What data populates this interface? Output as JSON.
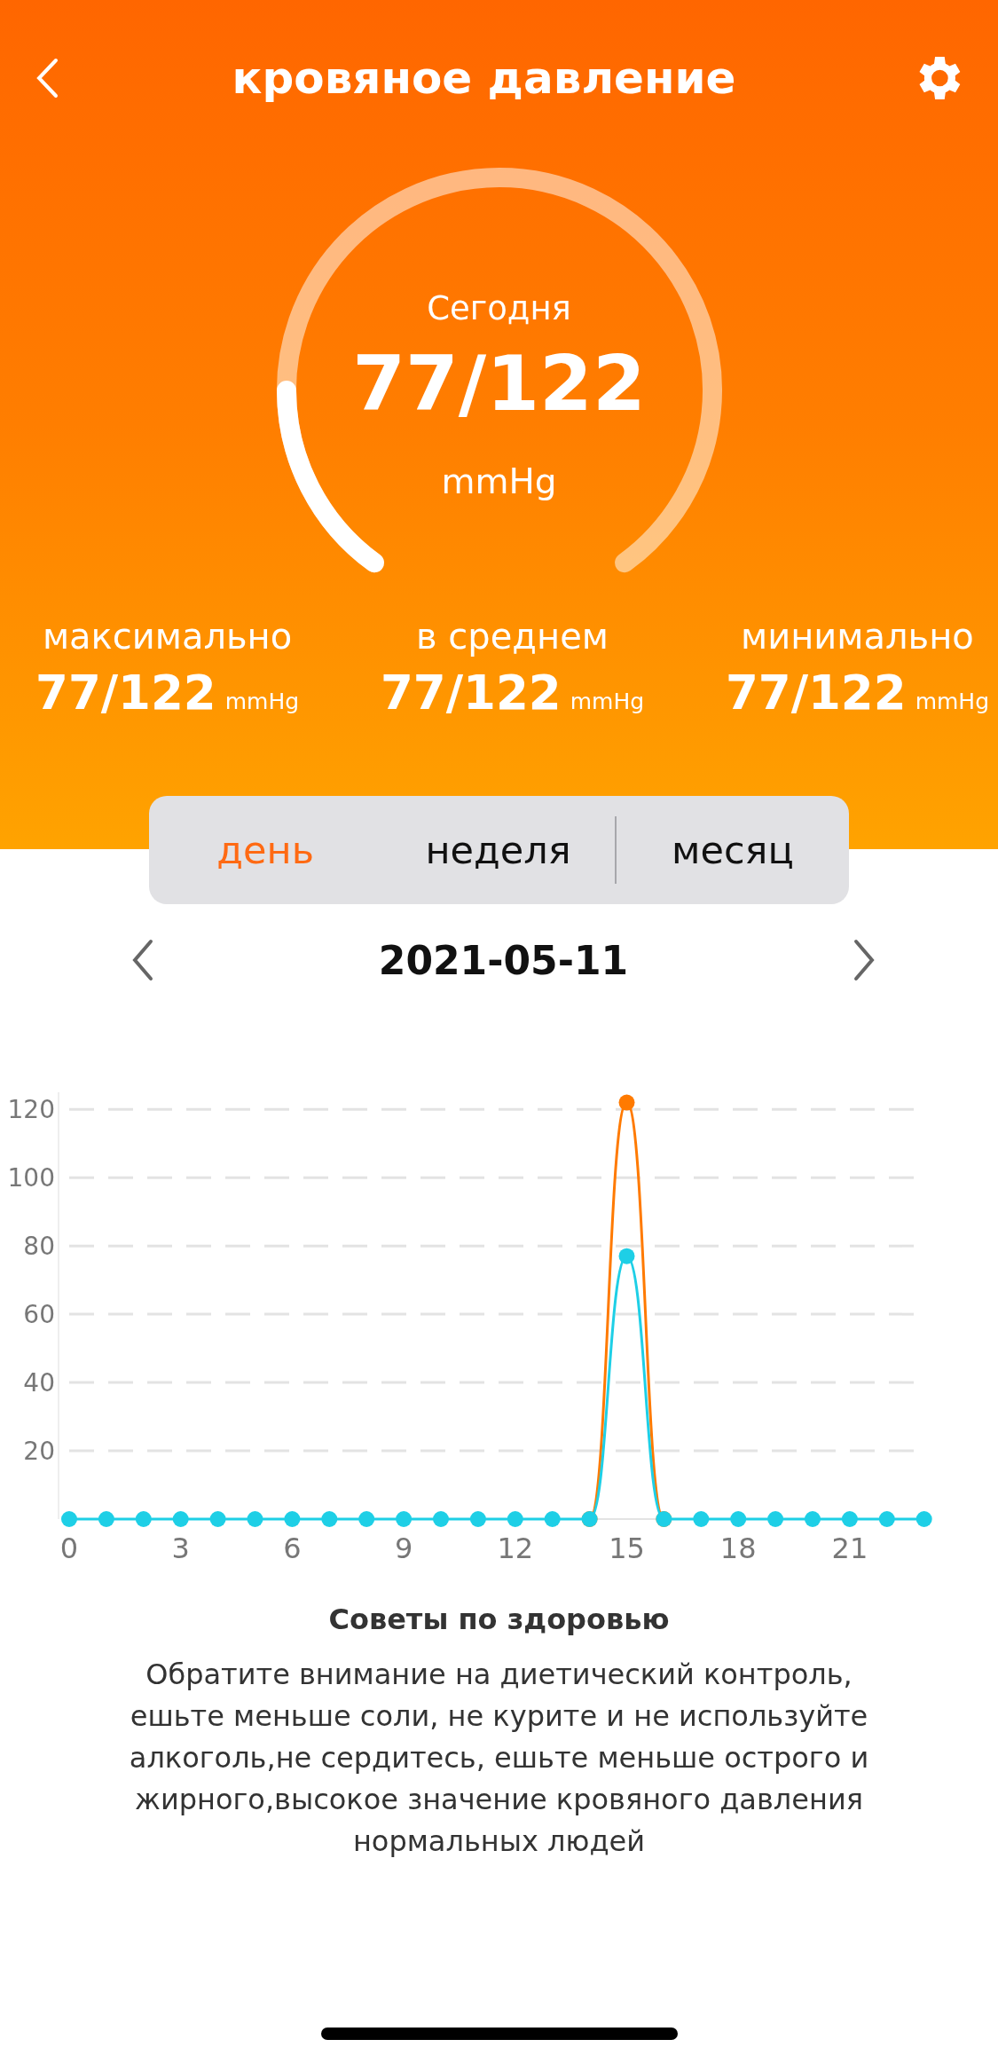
{
  "header": {
    "title": "кровяное давление"
  },
  "gauge": {
    "label": "Сегодня",
    "value": "77/122",
    "unit": "mmHg"
  },
  "stats": [
    {
      "label": "максимально",
      "value": "77/122",
      "unit": "mmHg"
    },
    {
      "label": "в среднем",
      "value": "77/122",
      "unit": "mmHg"
    },
    {
      "label": "минимально",
      "value": "77/122",
      "unit": "mmHg"
    }
  ],
  "tabs": [
    {
      "label": "день",
      "selected": true
    },
    {
      "label": "неделя",
      "selected": false
    },
    {
      "label": "месяц",
      "selected": false
    }
  ],
  "date": "2021-05-11",
  "chart_data": {
    "type": "line",
    "x": [
      0,
      1,
      2,
      3,
      4,
      5,
      6,
      7,
      8,
      9,
      10,
      11,
      12,
      13,
      14,
      15,
      16,
      17,
      18,
      19,
      20,
      21,
      22,
      23
    ],
    "xlim": [
      0,
      23
    ],
    "xticks": [
      0,
      3,
      6,
      9,
      12,
      15,
      18,
      21
    ],
    "yticks": [
      20,
      40,
      60,
      80,
      100,
      120
    ],
    "ylim": [
      0,
      125
    ],
    "grid": true,
    "series": [
      {
        "color": "#ff7a00",
        "marker": "circle",
        "values": [
          null,
          null,
          null,
          null,
          null,
          null,
          null,
          null,
          null,
          null,
          null,
          null,
          null,
          null,
          0,
          122,
          0,
          null,
          null,
          null,
          null,
          null,
          null,
          null
        ]
      },
      {
        "color": "#1ecfe6",
        "marker": "circle",
        "values": [
          0,
          0,
          0,
          0,
          0,
          0,
          0,
          0,
          0,
          0,
          0,
          0,
          0,
          0,
          0,
          77,
          0,
          0,
          0,
          0,
          0,
          0,
          0,
          0
        ]
      }
    ]
  },
  "tips": {
    "title": "Советы по здоровью",
    "text": "Обратите внимание на диетический контроль, ешьте меньше соли, не курите и  не используйте алкоголь,не сердитесь, ешьте меньше острого и жирного,высокое значение кровяного давления нормальных людей"
  }
}
